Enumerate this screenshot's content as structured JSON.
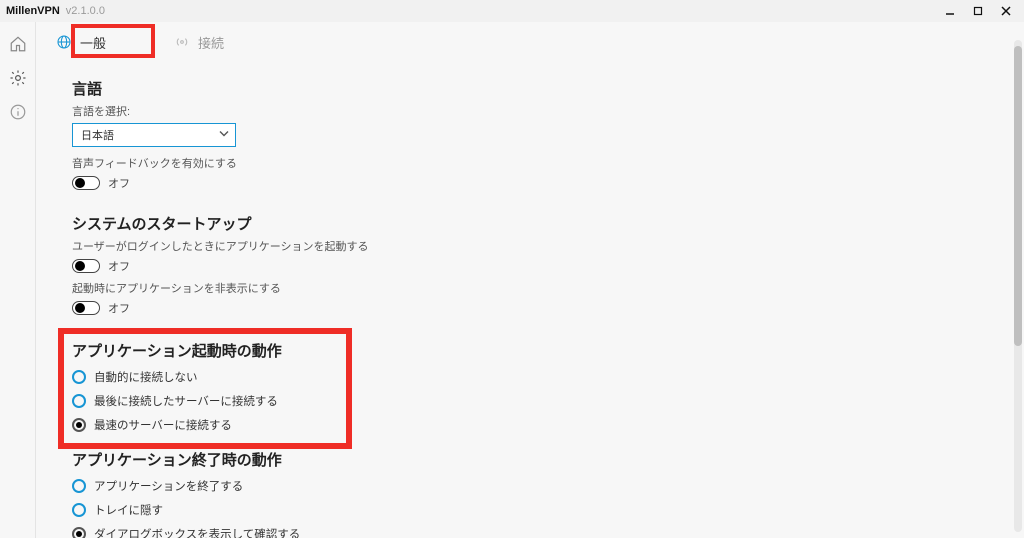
{
  "app": {
    "name": "MillenVPN",
    "version": "v2.1.0.0"
  },
  "sidebar": {
    "home_icon": "home",
    "settings_icon": "gear",
    "about_icon": "info"
  },
  "tabs": {
    "general": {
      "label": "一般",
      "active": true
    },
    "connection": {
      "label": "接続",
      "active": false
    }
  },
  "sections": {
    "language": {
      "title": "言語",
      "select_label": "言語を選択:",
      "selected_value": "日本語",
      "voice_feedback_label": "音声フィードバックを有効にする",
      "voice_feedback_state": "オフ"
    },
    "startup": {
      "title": "システムのスタートアップ",
      "login_launch_label": "ユーザーがログインしたときにアプリケーションを起動する",
      "login_launch_state": "オフ",
      "hide_on_launch_label": "起動時にアプリケーションを非表示にする",
      "hide_on_launch_state": "オフ"
    },
    "on_app_start": {
      "title": "アプリケーション起動時の動作",
      "options": [
        {
          "label": "自動的に接続しない",
          "selected": false
        },
        {
          "label": "最後に接続したサーバーに接続する",
          "selected": false
        },
        {
          "label": "最速のサーバーに接続する",
          "selected": true
        }
      ]
    },
    "on_app_quit": {
      "title": "アプリケーション終了時の動作",
      "options": [
        {
          "label": "アプリケーションを終了する",
          "selected": false
        },
        {
          "label": "トレイに隠す",
          "selected": false
        },
        {
          "label": "ダイアログボックスを表示して確認する",
          "selected": true
        }
      ]
    }
  },
  "colors": {
    "accent": "#1795d4",
    "highlight": "#ef2d26"
  }
}
